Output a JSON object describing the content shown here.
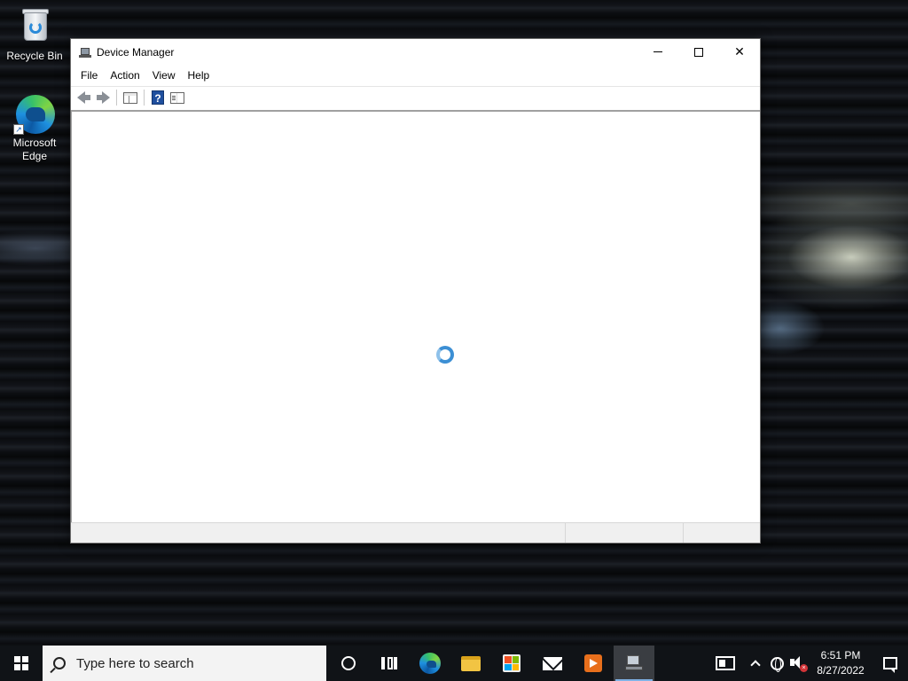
{
  "desktop": {
    "icons": [
      {
        "label": "Recycle Bin"
      },
      {
        "label": "Microsoft Edge"
      }
    ]
  },
  "window": {
    "title": "Device Manager",
    "controls": {
      "minimize": "",
      "maximize": "",
      "close": "✕"
    },
    "menu": [
      "File",
      "Action",
      "View",
      "Help"
    ],
    "toolbar": {
      "help_glyph": "?"
    },
    "loading": true
  },
  "taskbar": {
    "search_placeholder": "Type here to search",
    "apps": [
      "cortana",
      "task-view",
      "microsoft-edge",
      "file-explorer",
      "microsoft-store",
      "mail",
      "media-player",
      "device-manager"
    ],
    "active_app": "device-manager",
    "clock": {
      "time": "6:51 PM",
      "date": "8/27/2022"
    },
    "mute_badge": "×"
  },
  "colors": {
    "taskbar_bg": "#101317",
    "active_indicator": "#7fb2e6",
    "spinner": "#3c8fd4"
  }
}
